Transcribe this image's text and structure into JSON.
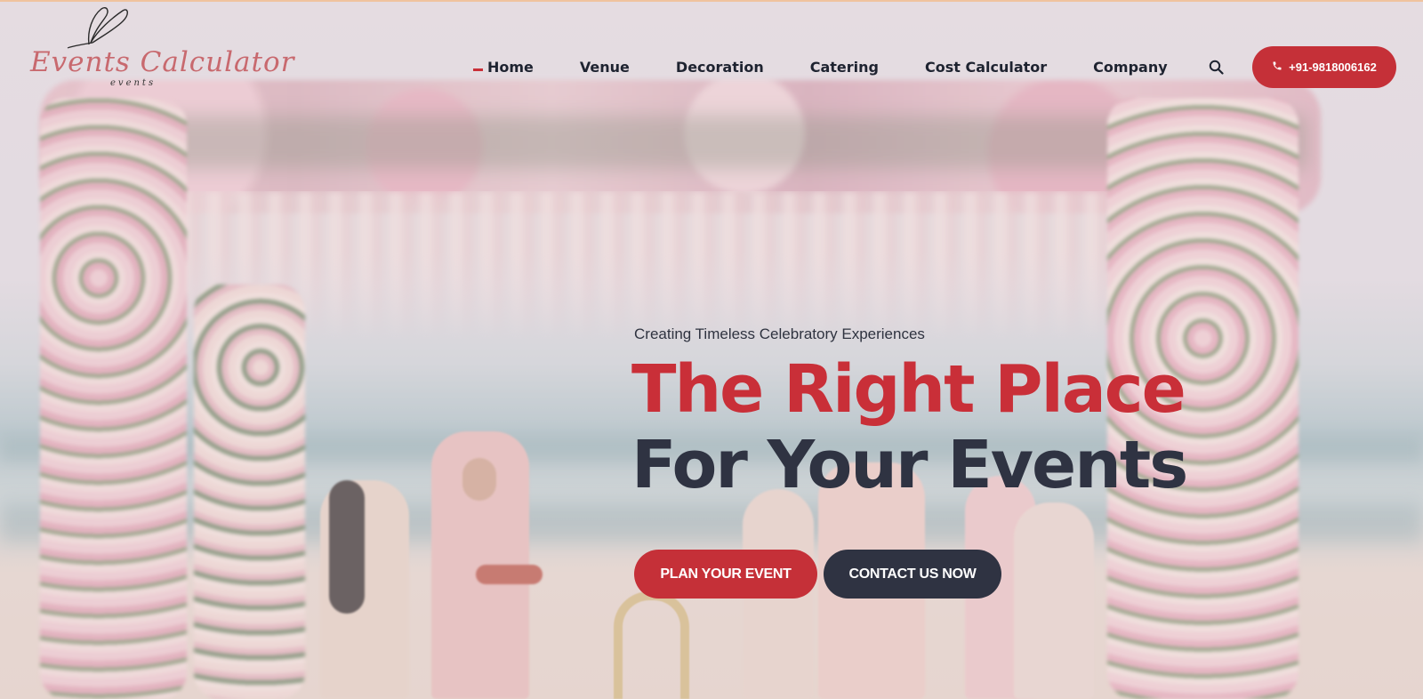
{
  "brand": {
    "logo_text": "Events Calculator",
    "logo_subtext": "events",
    "accent_color": "#c53038",
    "dark_color": "#2f3342"
  },
  "nav": {
    "items": [
      {
        "label": "Home",
        "active": true
      },
      {
        "label": "Venue",
        "active": false
      },
      {
        "label": "Decoration",
        "active": false
      },
      {
        "label": "Catering",
        "active": false
      },
      {
        "label": "Cost Calculator",
        "active": false
      },
      {
        "label": "Company",
        "active": false
      }
    ],
    "search_icon": "search-icon"
  },
  "phone_button": {
    "icon": "phone-icon",
    "label": "+91-9818006162"
  },
  "hero": {
    "tagline": "Creating Timeless Celebratory Experiences",
    "headline_line1": "The Right Place",
    "headline_line2": "For Your Events",
    "primary_button": "PLAN YOUR EVENT",
    "secondary_button": "CONTACT US NOW"
  }
}
